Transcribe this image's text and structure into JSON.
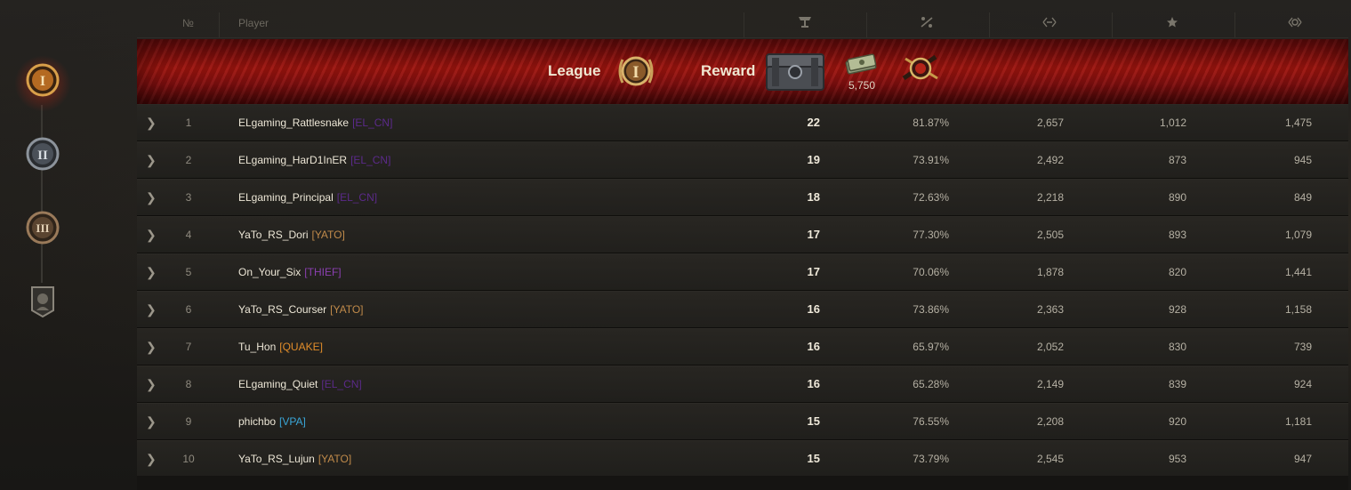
{
  "header": {
    "rank_label": "№",
    "player_label": "Player",
    "icons": [
      "battles-icon",
      "win-rate-icon",
      "damage-icon",
      "experience-icon",
      "rating-icon"
    ]
  },
  "banner": {
    "league_label": "League",
    "reward_label": "Reward",
    "cash_amount": "5,750",
    "league_icon": "league-1-medal-icon",
    "reward_icons": [
      "container-chest-icon",
      "credits-cash-icon",
      "rank-emblem-icon"
    ],
    "accent_color": "#a3150f"
  },
  "leagues": [
    {
      "name": "league-1",
      "numeral": "I",
      "active": true
    },
    {
      "name": "league-2",
      "numeral": "II",
      "active": false
    },
    {
      "name": "league-3",
      "numeral": "III",
      "active": false
    },
    {
      "name": "league-4",
      "numeral": "",
      "active": false
    }
  ],
  "rows": [
    {
      "rank": "1",
      "player": "ELgaming_Rattlesnake",
      "clan": "[EL_CN]",
      "clan_color": "#5b2a8a",
      "battles": "22",
      "winrate": "81.87%",
      "damage": "2,657",
      "xp": "1,012",
      "rating": "1,475"
    },
    {
      "rank": "2",
      "player": "ELgaming_HarD1InER",
      "clan": "[EL_CN]",
      "clan_color": "#5b2a8a",
      "battles": "19",
      "winrate": "73.91%",
      "damage": "2,492",
      "xp": "873",
      "rating": "945"
    },
    {
      "rank": "3",
      "player": "ELgaming_Principal",
      "clan": "[EL_CN]",
      "clan_color": "#5b2a8a",
      "battles": "18",
      "winrate": "72.63%",
      "damage": "2,218",
      "xp": "890",
      "rating": "849"
    },
    {
      "rank": "4",
      "player": "YaTo_RS_Dori",
      "clan": "[YATO]",
      "clan_color": "#c08a4a",
      "battles": "17",
      "winrate": "77.30%",
      "damage": "2,505",
      "xp": "893",
      "rating": "1,079"
    },
    {
      "rank": "5",
      "player": "On_Your_Six",
      "clan": "[THIEF]",
      "clan_color": "#8a3fb0",
      "battles": "17",
      "winrate": "70.06%",
      "damage": "1,878",
      "xp": "820",
      "rating": "1,441"
    },
    {
      "rank": "6",
      "player": "YaTo_RS_Courser",
      "clan": "[YATO]",
      "clan_color": "#c08a4a",
      "battles": "16",
      "winrate": "73.86%",
      "damage": "2,363",
      "xp": "928",
      "rating": "1,158"
    },
    {
      "rank": "7",
      "player": "Tu_Hon",
      "clan": "[QUAKE]",
      "clan_color": "#e08c2a",
      "battles": "16",
      "winrate": "65.97%",
      "damage": "2,052",
      "xp": "830",
      "rating": "739"
    },
    {
      "rank": "8",
      "player": "ELgaming_Quiet",
      "clan": "[EL_CN]",
      "clan_color": "#5b2a8a",
      "battles": "16",
      "winrate": "65.28%",
      "damage": "2,149",
      "xp": "839",
      "rating": "924"
    },
    {
      "rank": "9",
      "player": "phichbo",
      "clan": "[VPA]",
      "clan_color": "#3aa6d8",
      "battles": "15",
      "winrate": "76.55%",
      "damage": "2,208",
      "xp": "920",
      "rating": "1,181"
    },
    {
      "rank": "10",
      "player": "YaTo_RS_Lujun",
      "clan": "[YATO]",
      "clan_color": "#c08a4a",
      "battles": "15",
      "winrate": "73.79%",
      "damage": "2,545",
      "xp": "953",
      "rating": "947"
    }
  ]
}
